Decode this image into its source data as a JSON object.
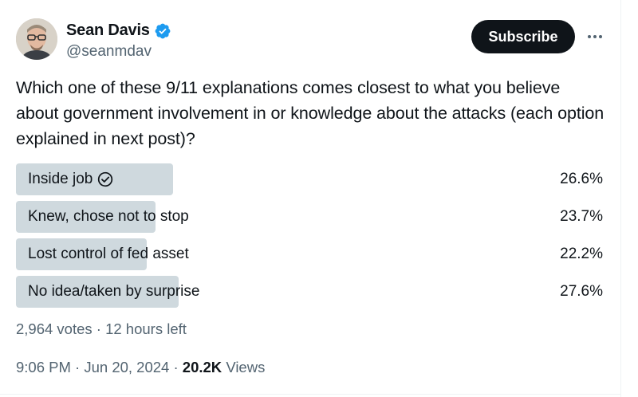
{
  "author": {
    "name": "Sean Davis",
    "handle": "@seanmdav",
    "verified": true,
    "verified_color": "#1d9bf0"
  },
  "actions": {
    "subscribe_label": "Subscribe",
    "more_icon": "more-horizontal-icon"
  },
  "post": {
    "text": "Which one of these 9/11 explanations comes closest to what you believe about government involvement in or knowledge about the attacks (each option explained in next post)?"
  },
  "poll": {
    "options": [
      {
        "label": "Inside job",
        "percent": "26.6%",
        "fraction": 0.266,
        "selected": true
      },
      {
        "label": "Knew, chose not to stop",
        "percent": "23.7%",
        "fraction": 0.237,
        "selected": false
      },
      {
        "label": "Lost control of fed asset",
        "percent": "22.2%",
        "fraction": 0.222,
        "selected": false
      },
      {
        "label": "No idea/taken by surprise",
        "percent": "27.6%",
        "fraction": 0.276,
        "selected": false
      }
    ],
    "bar_color": "#cfd9de",
    "summary": "2,964 votes · 12 hours left"
  },
  "meta": {
    "time": "9:06 PM",
    "date": "Jun 20, 2024",
    "views_count": "20.2K",
    "views_label": "Views"
  }
}
